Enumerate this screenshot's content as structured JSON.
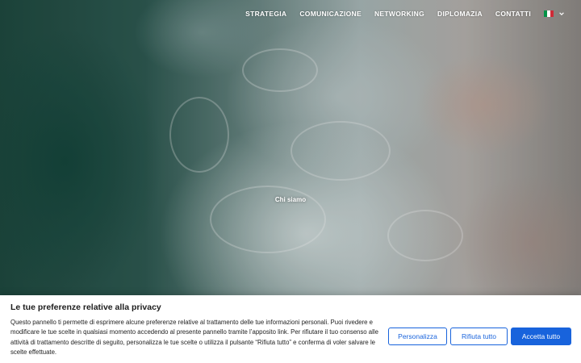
{
  "nav": {
    "items": [
      {
        "label": "STRATEGIA"
      },
      {
        "label": "COMUNICAZIONE"
      },
      {
        "label": "NETWORKING"
      },
      {
        "label": "DIPLOMAZIA"
      },
      {
        "label": "CONTATTI"
      }
    ],
    "language": {
      "icon": "italian-flag-icon",
      "chevron_icon": "chevron-down-icon"
    }
  },
  "hero": {
    "label": "Chi siamo"
  },
  "cookie_banner": {
    "title": "Le tue preferenze relative alla privacy",
    "text": "Questo pannello ti permette di esprimere alcune preferenze relative al trattamento delle tue informazioni personali. Puoi rivedere e modificare le tue scelte in qualsiasi momento accedendo al presente pannello tramite l’apposito link. Per rifiutare il tuo consenso alle attività di trattamento descritte di seguito, personalizza le tue scelte o utilizza il pulsante “Rifiuta tutto” e conferma di voler salvare le scelte effettuate.",
    "customize_label": "Personalizza",
    "reject_label": "Rifiuta tutto",
    "accept_label": "Accetta tutto"
  },
  "colors": {
    "accent": "#1863dc",
    "flag_green": "#009246",
    "flag_white": "#ffffff",
    "flag_red": "#ce2b37"
  }
}
